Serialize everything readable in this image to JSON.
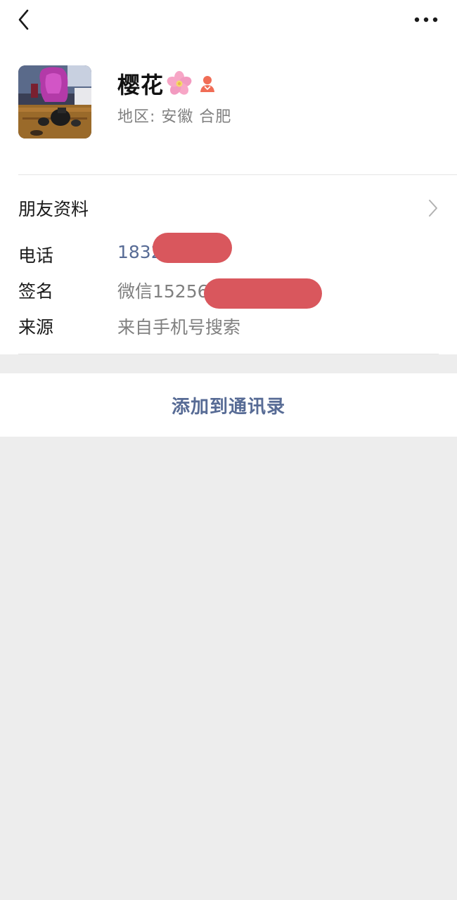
{
  "header": {
    "back_icon": "chevron-left-icon",
    "more_icon": "more-dots-icon"
  },
  "profile": {
    "name": "樱花",
    "name_emoji_icon": "cherry-blossom-icon",
    "gender_icon": "female-user-icon",
    "region": "地区: 安徽  合肥",
    "avatar_icon": "avatar-photo"
  },
  "friend_info": {
    "label": "朋友资料",
    "arrow_icon": "chevron-right-icon"
  },
  "details": {
    "phone_label": "电话",
    "phone_value": "1832        7",
    "signature_label": "签名",
    "signature_value": "微信15256",
    "source_label": "来源",
    "source_value": "来自手机号搜索"
  },
  "actions": {
    "add_label": "添加到通讯录"
  },
  "colors": {
    "link": "#576b95",
    "redaction": "#d9575d",
    "background": "#ededed"
  }
}
